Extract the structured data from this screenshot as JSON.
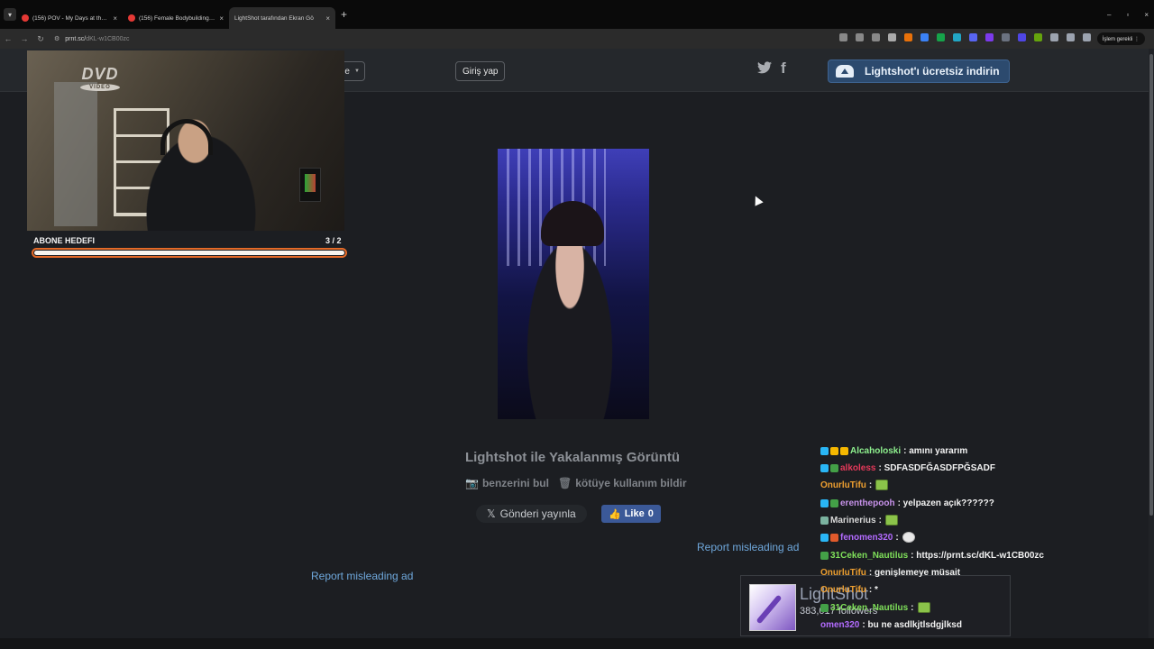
{
  "browser": {
    "tabs": [
      {
        "title": "(156) POV - My Days at the Co",
        "close": "×"
      },
      {
        "title": "(156) Female Bodybuilding Pro",
        "close": "×"
      },
      {
        "title": "LightShot tarafından Ekran Gö",
        "close": "×"
      }
    ],
    "new_tab": "+",
    "window_controls": [
      "–",
      "▫",
      "×"
    ],
    "url_domain": "prnt.sc/",
    "url_path": "dKL-w1CB00zc",
    "action_pill": "İşlem gerekli ⋮"
  },
  "site": {
    "language_label": "rkçe",
    "login_label": "Giriş yap",
    "twitter_icon": "twitter-icon",
    "facebook_icon": "facebook-icon",
    "download_label": "Lightshot'ı ücretsiz indirin",
    "caption": "Lightshot ile Yakalanmış Görüntü",
    "find_similar": "benzerini bul",
    "report_abuse": "kötüye kullanım bildir",
    "tweet_label": "Gönderi yayınla",
    "like_label": "Like",
    "like_count": "0",
    "report_ad_1": "Report misleading ad",
    "report_ad_2": "Report misleading ad"
  },
  "overlay": {
    "dvd_logo": "DVD",
    "dvd_sub": "VIDEO",
    "goal_label": "ABONE HEDEFI",
    "goal_count": "3  / 2",
    "goal_progress": 1.0,
    "goal_color": "#e46a28",
    "follow_name": "LightShot",
    "follow_count": "383,017 followers"
  },
  "chat": [
    {
      "user": "Alcaholoski",
      "color": "#8ef08e",
      "msg": ": amını yararım",
      "badges": [
        "#29b6f6",
        "#f5b700",
        "#f5b700"
      ],
      "emote": false
    },
    {
      "user": "alkoless",
      "color": "#e5395a",
      "msg": ": SDFASDFĞASDFPĞSADF",
      "badges": [
        "#29b6f6",
        "#43a047"
      ],
      "emote": false
    },
    {
      "user": "OnurluTifu",
      "color": "#f0a030",
      "msg": ":",
      "badges": [],
      "emote": true
    },
    {
      "user": "erenthepooh",
      "color": "#c792ea",
      "msg": ": yelpazen açık??????",
      "badges": [
        "#29b6f6",
        "#43a047"
      ],
      "emote": false
    },
    {
      "user": "Marinerius",
      "color": "#d9d9d9",
      "msg": ":",
      "badges": [
        "#7bb3a0"
      ],
      "emote": true
    },
    {
      "user": "fenomen320",
      "color": "#b36bff",
      "msg": ":",
      "badges": [
        "#29b6f6",
        "#e05a2b"
      ],
      "emote": true
    },
    {
      "user": "31Ceken_Nautilus",
      "color": "#7fe05a",
      "msg": ": https://prnt.sc/dKL-w1CB00zc",
      "badges": [
        "#43a047"
      ],
      "emote": false
    },
    {
      "user": "OnurluTifu",
      "color": "#f0a030",
      "msg": ": genişlemeye müsait",
      "badges": [],
      "emote": false
    },
    {
      "user": "OnurluTifu",
      "color": "#f0a030",
      "msg": ": *",
      "badges": [],
      "emote": false
    },
    {
      "user": "31Ceken_Nautilus",
      "color": "#7fe05a",
      "msg": ":",
      "badges": [
        "#43a047"
      ],
      "emote": true
    },
    {
      "user": "omen320",
      "color": "#b36bff",
      "msg": ": bu ne asdlkjtlsdgjlksd",
      "badges": [],
      "emote": false
    }
  ]
}
